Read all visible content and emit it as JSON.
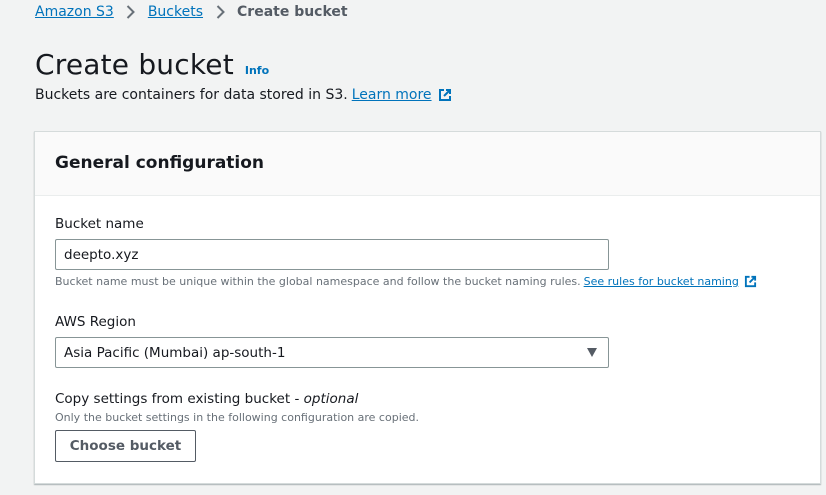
{
  "breadcrumb": {
    "items": [
      "Amazon S3",
      "Buckets"
    ],
    "current": "Create bucket"
  },
  "header": {
    "title": "Create bucket",
    "info": "Info",
    "description": "Buckets are containers for data stored in S3.",
    "learn_more": "Learn more"
  },
  "panel": {
    "title": "General configuration",
    "bucket_name": {
      "label": "Bucket name",
      "value": "deepto.xyz",
      "hint": "Bucket name must be unique within the global namespace and follow the bucket naming rules.",
      "hint_link": "See rules for bucket naming"
    },
    "region": {
      "label": "AWS Region",
      "selected": "Asia Pacific (Mumbai) ap-south-1"
    },
    "copy_settings": {
      "label": "Copy settings from existing bucket - ",
      "label_optional": "optional",
      "hint": "Only the bucket settings in the following configuration are copied.",
      "button": "Choose bucket"
    }
  },
  "icons": {
    "breadcrumb_separator": "chevron-right-icon",
    "external": "external-link-icon",
    "select_caret": "caret-down-icon"
  },
  "colors": {
    "link": "#0073bb",
    "background": "#f2f3f3",
    "panel": "#ffffff",
    "text": "#16191f",
    "muted": "#687078"
  }
}
